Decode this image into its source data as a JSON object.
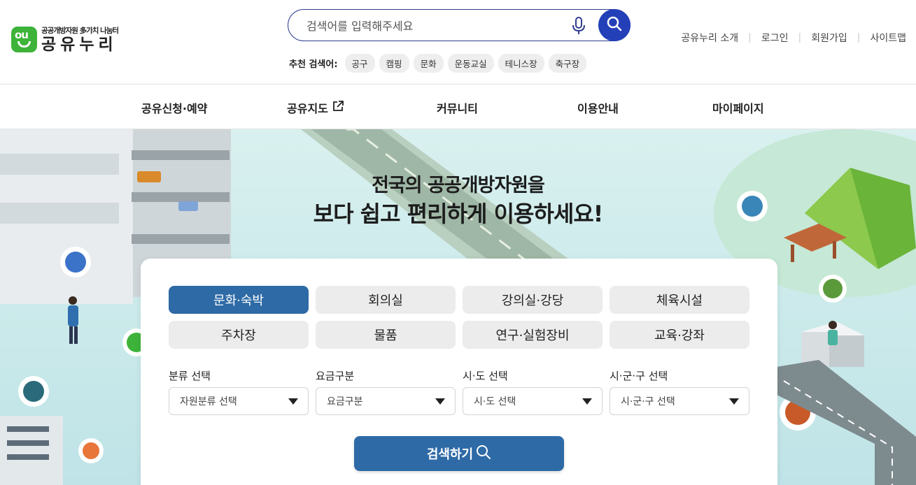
{
  "logo": {
    "sub": "공공개방자원 多가치 나눔터",
    "main": "공유누리"
  },
  "search": {
    "placeholder": "검색어를 입력해주세요"
  },
  "recommend": {
    "label": "추천 검색어:",
    "chips": [
      "공구",
      "캠핑",
      "문화",
      "운동교실",
      "테니스장",
      "축구장"
    ]
  },
  "util_links": [
    "공유누리 소개",
    "로그인",
    "회원가입",
    "사이트맵"
  ],
  "nav": [
    "공유신청·예약",
    "공유지도",
    "커뮤니티",
    "이용안내",
    "마이페이지"
  ],
  "hero": {
    "line1": "전국의 공공개방자원을",
    "line2": "보다 쉽고 편리하게 이용하세요!"
  },
  "categories": [
    "문화·숙박",
    "회의실",
    "강의실·강당",
    "체육시설",
    "주차장",
    "물품",
    "연구·실험장비",
    "교육·강좌"
  ],
  "active_category": "문화·숙박",
  "filters": [
    {
      "label": "분류 선택",
      "value": "자원분류 선택"
    },
    {
      "label": "요금구분",
      "value": "요금구분"
    },
    {
      "label": "시·도 선택",
      "value": "시·도 선택"
    },
    {
      "label": "시·군·구 선택",
      "value": "시·군·구 선택"
    }
  ],
  "submit_label": "검색하기",
  "colors": {
    "brand_green": "#3db33a",
    "primary_blue": "#2e6aa6",
    "search_blue": "#2440b8"
  }
}
